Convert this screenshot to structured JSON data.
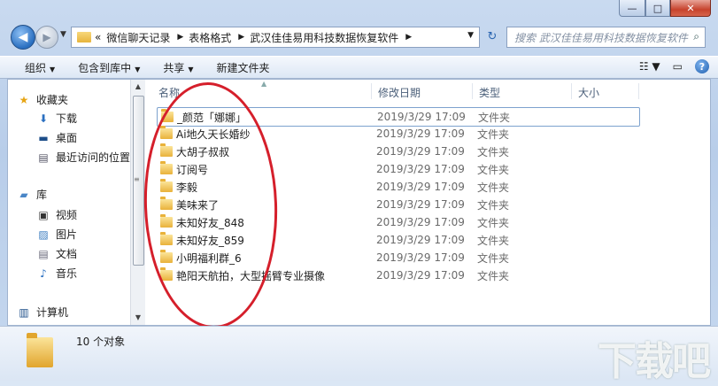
{
  "window": {
    "caption_buttons": {
      "minimize": "—",
      "maximize": "□",
      "close": "✕"
    }
  },
  "address": {
    "overflow": "«",
    "crumbs": [
      "微信聊天记录",
      "表格格式",
      "武汉佳佳易用科技数据恢复软件"
    ],
    "search_placeholder": "搜索 武汉佳佳易用科技数据恢复软件"
  },
  "toolbar": {
    "organize": "组织",
    "include_library": "包含到库中",
    "share": "共享",
    "new_folder": "新建文件夹"
  },
  "nav": {
    "favorites": "收藏夹",
    "downloads": "下载",
    "desktop": "桌面",
    "recent": "最近访问的位置",
    "libraries": "库",
    "videos": "视频",
    "pictures": "图片",
    "documents": "文档",
    "music": "音乐",
    "computer": "计算机"
  },
  "columns": {
    "name": "名称",
    "date": "修改日期",
    "type": "类型",
    "size": "大小"
  },
  "files": [
    {
      "name": "_颜范「娜娜」",
      "date": "2019/3/29 17:09",
      "type": "文件夹"
    },
    {
      "name": "Ai地久天长婚纱",
      "date": "2019/3/29 17:09",
      "type": "文件夹"
    },
    {
      "name": "大胡子叔叔",
      "date": "2019/3/29 17:09",
      "type": "文件夹"
    },
    {
      "name": "订阅号",
      "date": "2019/3/29 17:09",
      "type": "文件夹"
    },
    {
      "name": "李毅",
      "date": "2019/3/29 17:09",
      "type": "文件夹"
    },
    {
      "name": "美味来了",
      "date": "2019/3/29 17:09",
      "type": "文件夹"
    },
    {
      "name": "未知好友_848",
      "date": "2019/3/29 17:09",
      "type": "文件夹"
    },
    {
      "name": "未知好友_859",
      "date": "2019/3/29 17:09",
      "type": "文件夹"
    },
    {
      "name": "小明福利群_6",
      "date": "2019/3/29 17:09",
      "type": "文件夹"
    },
    {
      "name": "艳阳天航拍，大型摇臂专业摄像",
      "date": "2019/3/29 17:09",
      "type": "文件夹"
    }
  ],
  "details": {
    "count": "10 个对象"
  },
  "watermark": "下载吧",
  "colors": {
    "annotation": "#d51f2b",
    "folder": "#e9b23a",
    "accent": "#2a6fc0"
  }
}
